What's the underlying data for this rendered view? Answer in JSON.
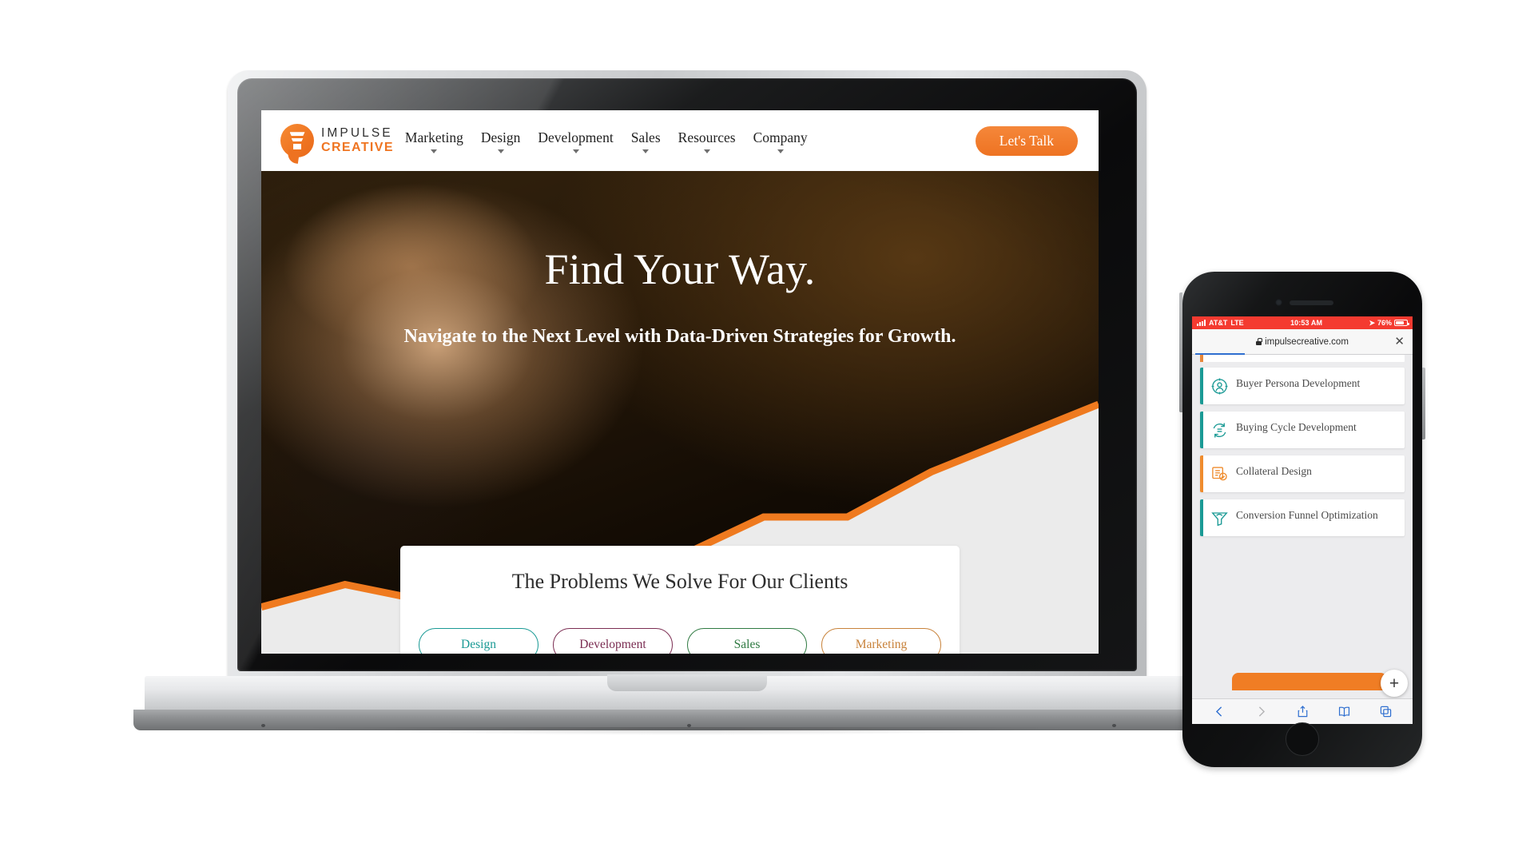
{
  "laptop": {
    "site": {
      "logo": {
        "top": "IMPULSE",
        "bottom": "CREATIVE",
        "icon": "funnel-bubble-icon"
      },
      "nav_items": [
        {
          "label": "Marketing"
        },
        {
          "label": "Design"
        },
        {
          "label": "Development"
        },
        {
          "label": "Sales"
        },
        {
          "label": "Resources"
        },
        {
          "label": "Company"
        }
      ],
      "cta": "Let's Talk",
      "hero": {
        "headline": "Find Your Way.",
        "subheadline": "Navigate to the Next Level with Data-Driven Strategies for Growth."
      },
      "problems": {
        "title": "The Problems We Solve For Our Clients",
        "pills": [
          {
            "label": "Design",
            "color": "#1a9a95"
          },
          {
            "label": "Development",
            "color": "#7b2d52"
          },
          {
            "label": "Sales",
            "color": "#2f7a42"
          },
          {
            "label": "Marketing",
            "color": "#c8823a"
          }
        ]
      }
    }
  },
  "phone": {
    "status": {
      "carrier": "AT&T",
      "network": "LTE",
      "time": "10:53 AM",
      "battery": "76%"
    },
    "browser": {
      "url": "impulsecreative.com",
      "close_label": "✕",
      "secure_icon": "lock-icon"
    },
    "services": [
      {
        "label": "Buyer Persona Development",
        "accent": "#1a9a95",
        "icon": "persona-target-icon"
      },
      {
        "label": "Buying Cycle Development",
        "accent": "#1a9a95",
        "icon": "cycle-arrows-icon"
      },
      {
        "label": "Collateral Design",
        "accent": "#ef8c2e",
        "icon": "collateral-board-icon"
      },
      {
        "label": "Conversion Funnel Optimization",
        "accent": "#1a9a95",
        "icon": "funnel-icon"
      }
    ],
    "fab_label": "+",
    "toolbar": [
      {
        "icon": "back-chevron-icon",
        "state": "active"
      },
      {
        "icon": "forward-chevron-icon",
        "state": "disabled"
      },
      {
        "icon": "share-icon",
        "state": "active"
      },
      {
        "icon": "bookmarks-icon",
        "state": "active"
      },
      {
        "icon": "tabs-icon",
        "state": "active"
      }
    ]
  },
  "chart_data": {
    "type": "area",
    "title": "Growth trend background graphic",
    "x": [
      0,
      1,
      2,
      3,
      4,
      5,
      6,
      7,
      8,
      9,
      10
    ],
    "values": [
      12,
      20,
      14,
      11,
      30,
      30,
      44,
      44,
      60,
      72,
      84
    ],
    "line_color": "#ef7a1f",
    "fill_color": "#ebebeb",
    "xlabel": "",
    "ylabel": "",
    "grid": false,
    "legend": "none"
  }
}
